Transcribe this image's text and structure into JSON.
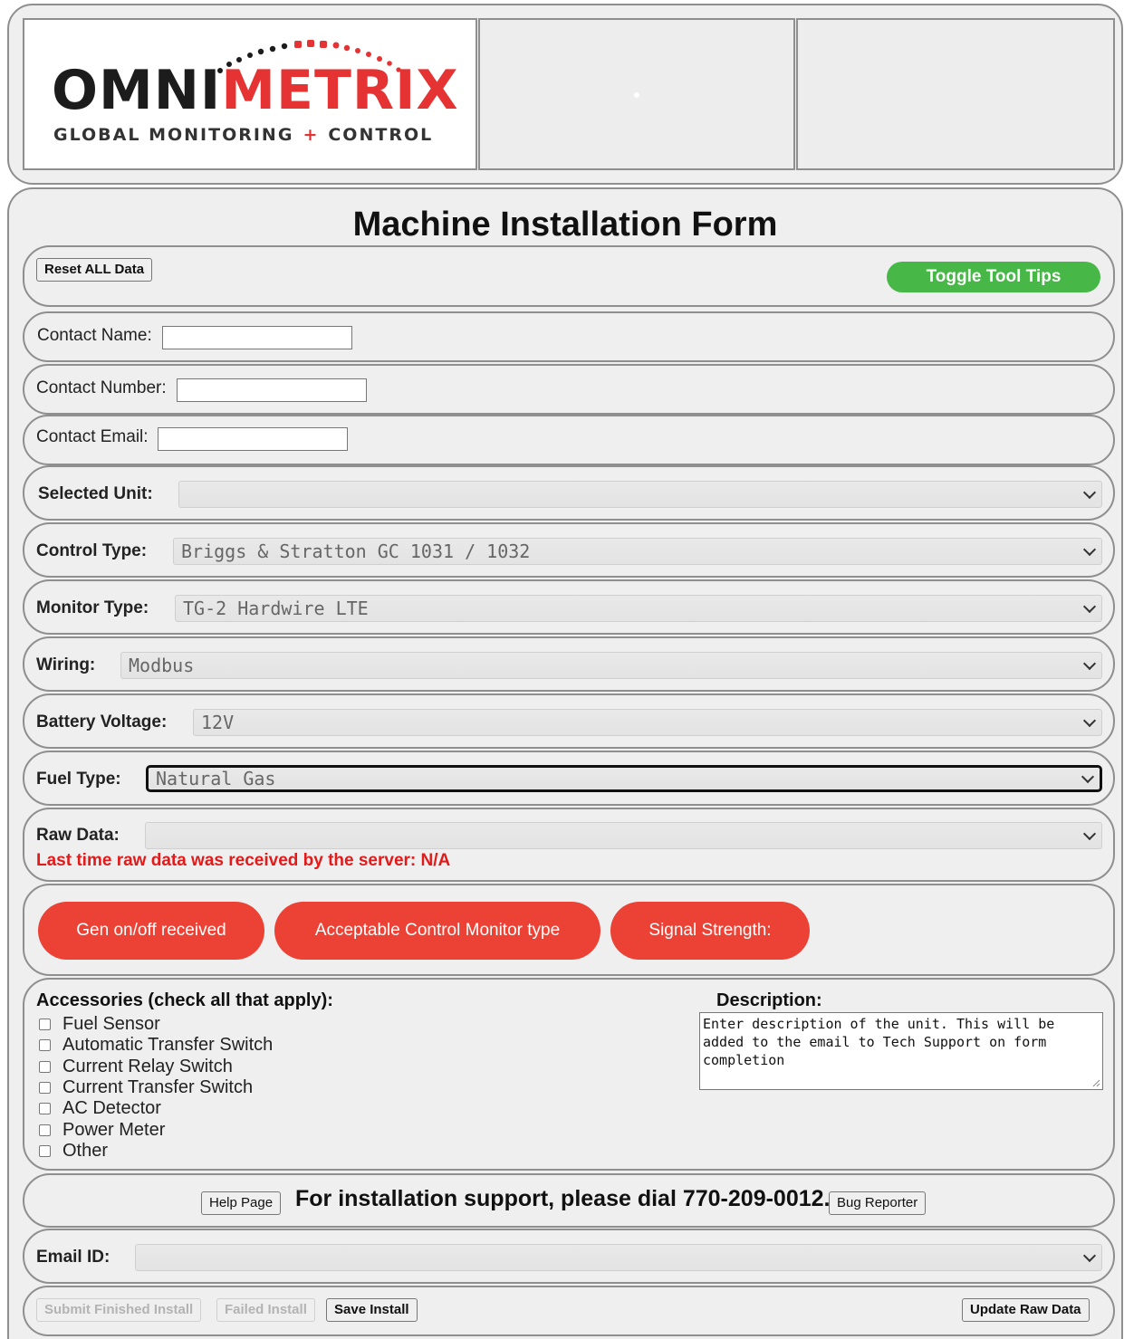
{
  "header": {
    "logo": {
      "word_dark": "OMNI",
      "word_red": "METRIX",
      "tagline_left": "GLOBAL MONITORING",
      "tagline_plus": "+",
      "tagline_right": "CONTROL"
    }
  },
  "form": {
    "title": "Machine Installation Form",
    "reset_button": "Reset ALL Data",
    "toggle_tooltips_button": "Toggle Tool Tips",
    "contact_name": {
      "label": "Contact Name:",
      "value": ""
    },
    "contact_number": {
      "label": "Contact Number:",
      "value": ""
    },
    "contact_email": {
      "label": "Contact Email:",
      "value": ""
    },
    "selected_unit": {
      "label": "Selected Unit:",
      "value": ""
    },
    "control_type": {
      "label": "Control Type:",
      "value": "Briggs & Stratton GC 1031 / 1032"
    },
    "monitor_type": {
      "label": "Monitor Type:",
      "value": "TG-2 Hardwire LTE"
    },
    "wiring": {
      "label": "Wiring:",
      "value": "Modbus"
    },
    "battery_voltage": {
      "label": "Battery Voltage:",
      "value": "12V"
    },
    "fuel_type": {
      "label": "Fuel Type:",
      "value": "Natural Gas"
    },
    "raw_data": {
      "label": "Raw Data:",
      "value": "",
      "last_received": "Last time raw data was received by the server: N/A"
    },
    "status_pills": [
      "Gen on/off received",
      "Acceptable Control Monitor type",
      "Signal Strength:"
    ],
    "accessories": {
      "title": "Accessories (check all that apply):",
      "items": [
        "Fuel Sensor",
        "Automatic Transfer Switch",
        "Current Relay Switch",
        "Current Transfer Switch",
        "AC Detector",
        "Power Meter",
        "Other"
      ]
    },
    "description": {
      "title": "Description:",
      "placeholder": "Enter description of the unit. This will be added to the email to Tech Support on form completion"
    },
    "support": {
      "help_button": "Help Page",
      "text": "For installation support, please dial 770-209-0012.",
      "bug_button": "Bug Reporter"
    },
    "email_id": {
      "label": "Email ID:",
      "value": ""
    },
    "footer_buttons": {
      "submit": "Submit Finished Install",
      "failed": "Failed Install",
      "save": "Save Install",
      "update_raw": "Update Raw Data"
    }
  },
  "colors": {
    "green_button": "#47b847",
    "red_pill": "#eb4235",
    "warning_text": "#e21a1a",
    "brand_red": "#e53232"
  }
}
